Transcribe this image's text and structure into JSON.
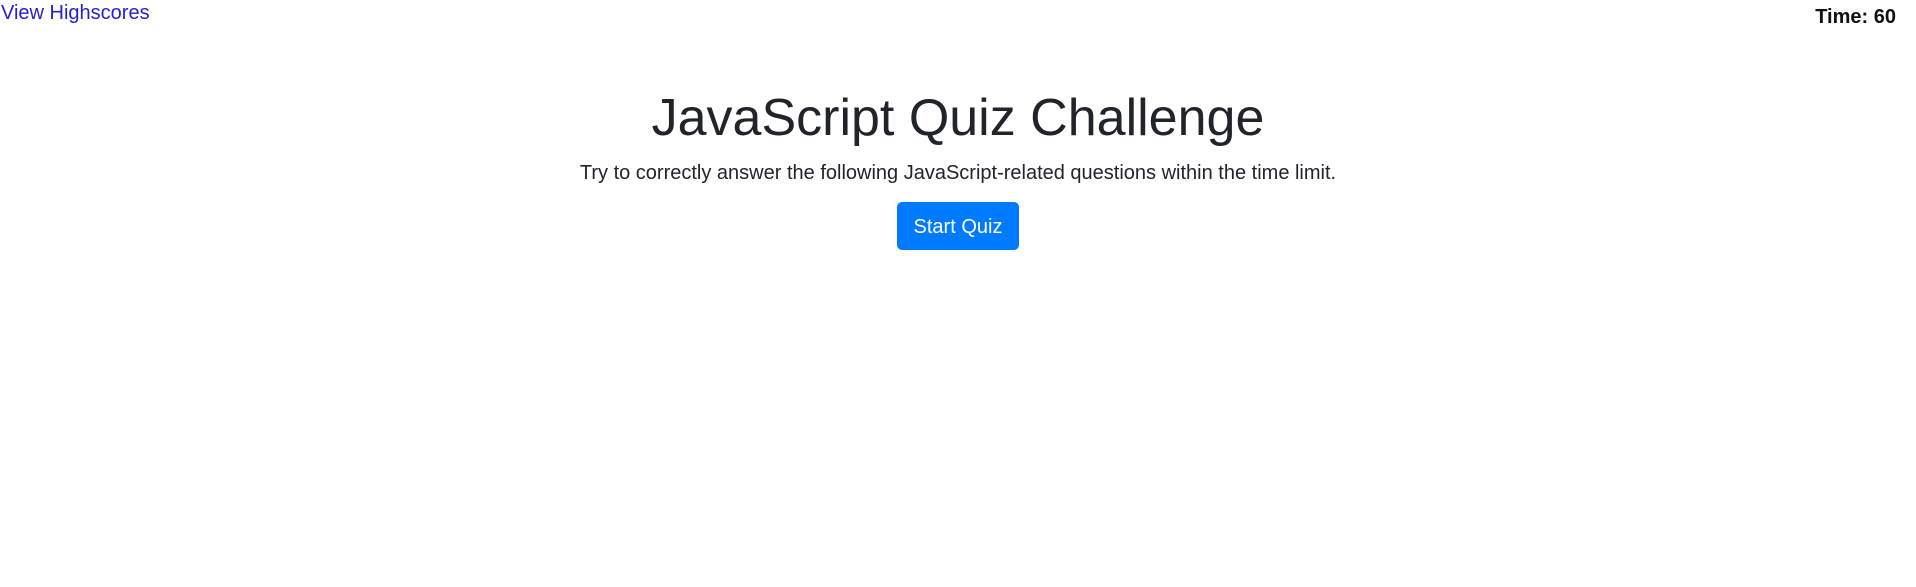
{
  "header": {
    "highscores_link": "View Highscores",
    "timer_label": "Time:",
    "timer_value": "60"
  },
  "main": {
    "title": "JavaScript Quiz Challenge",
    "subtitle": "Try to correctly answer the following JavaScript-related questions within the time limit.",
    "start_button": "Start Quiz"
  },
  "colors": {
    "link": "#2621cf",
    "primary_button": "#007bff",
    "text": "#212529",
    "background": "#ffffff"
  }
}
